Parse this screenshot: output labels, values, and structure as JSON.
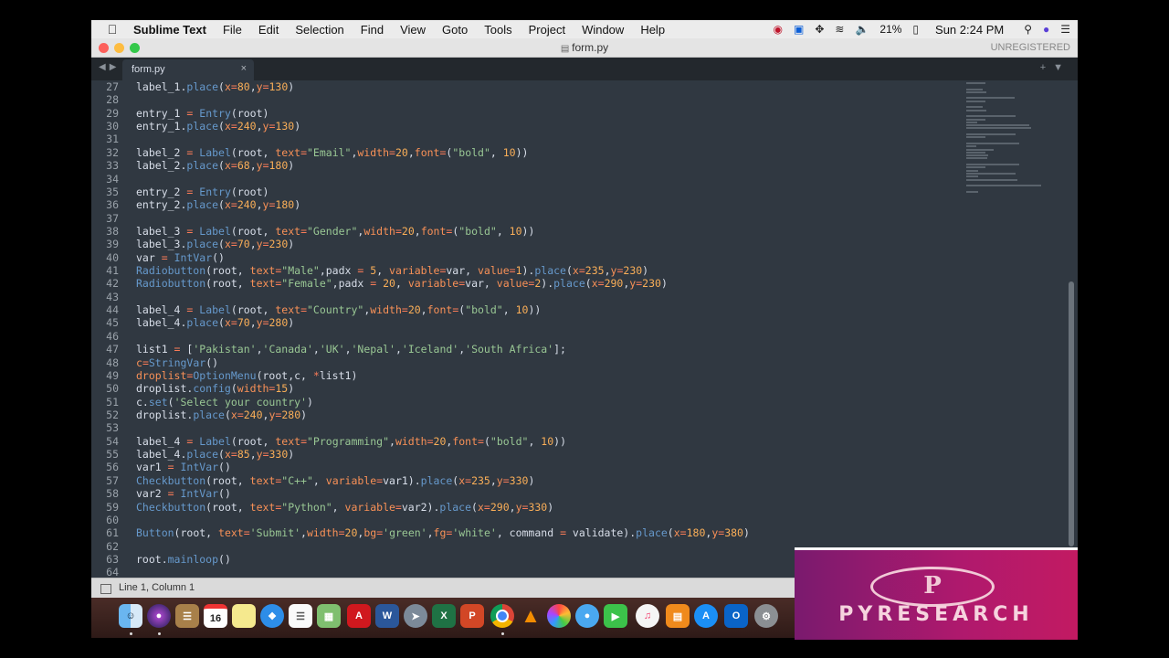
{
  "menubar": {
    "app": "Sublime Text",
    "items": [
      "File",
      "Edit",
      "Selection",
      "Find",
      "View",
      "Goto",
      "Tools",
      "Project",
      "Window",
      "Help"
    ],
    "battery": "21%",
    "clock": "Sun 2:24 PM"
  },
  "window": {
    "title": "form.py",
    "unregistered": "UNREGISTERED"
  },
  "tab": {
    "label": "form.py",
    "close": "×"
  },
  "editor": {
    "line_numbers": [
      "27",
      "28",
      "29",
      "30",
      "31",
      "32",
      "33",
      "34",
      "35",
      "36",
      "37",
      "38",
      "39",
      "40",
      "41",
      "42",
      "43",
      "44",
      "45",
      "46",
      "47",
      "48",
      "49",
      "50",
      "51",
      "52",
      "53",
      "54",
      "55",
      "56",
      "57",
      "58",
      "59",
      "60",
      "61",
      "62",
      "63",
      "64"
    ],
    "lines": [
      "label_1.place(x=80,y=130)",
      "",
      "entry_1 = Entry(root)",
      "entry_1.place(x=240,y=130)",
      "",
      "label_2 = Label(root, text=\"Email\",width=20,font=(\"bold\", 10))",
      "label_2.place(x=68,y=180)",
      "",
      "entry_2 = Entry(root)",
      "entry_2.place(x=240,y=180)",
      "",
      "label_3 = Label(root, text=\"Gender\",width=20,font=(\"bold\", 10))",
      "label_3.place(x=70,y=230)",
      "var = IntVar()",
      "Radiobutton(root, text=\"Male\",padx = 5, variable=var, value=1).place(x=235,y=230)",
      "Radiobutton(root, text=\"Female\",padx = 20, variable=var, value=2).place(x=290,y=230)",
      "",
      "label_4 = Label(root, text=\"Country\",width=20,font=(\"bold\", 10))",
      "label_4.place(x=70,y=280)",
      "",
      "list1 = ['Pakistan','Canada','UK','Nepal','Iceland','South Africa'];",
      "c=StringVar()",
      "droplist=OptionMenu(root,c, *list1)",
      "droplist.config(width=15)",
      "c.set('Select your country')",
      "droplist.place(x=240,y=280)",
      "",
      "label_4 = Label(root, text=\"Programming\",width=20,font=(\"bold\", 10))",
      "label_4.place(x=85,y=330)",
      "var1 = IntVar()",
      "Checkbutton(root, text=\"C++\", variable=var1).place(x=235,y=330)",
      "var2 = IntVar()",
      "Checkbutton(root, text=\"Python\", variable=var2).place(x=290,y=330)",
      "",
      "Button(root, text='Submit',width=20,bg='green',fg='white', command = validate).place(x=180,y=380)",
      "",
      "root.mainloop()",
      ""
    ]
  },
  "statusbar": {
    "position": "Line 1, Column 1"
  },
  "dock": {
    "calendar_day": "16",
    "apps": [
      "finder-icon",
      "siri-icon",
      "notes-icon",
      "calendar-icon",
      "stickies-icon",
      "safari-icon",
      "reminders-icon",
      "preview-icon",
      "acrobat-icon",
      "word-icon",
      "launchpad-icon",
      "excel-icon",
      "powerpoint-icon",
      "chrome-icon",
      "vlc-icon",
      "photos-icon",
      "messages-icon",
      "facetime-icon",
      "music-icon",
      "books-icon",
      "appstore-icon",
      "outlook-icon",
      "settings-icon"
    ]
  },
  "overlay": {
    "logo_letter": "P",
    "logo_text": "PYRESEARCH"
  },
  "colors": {
    "editor_bg": "#303841",
    "keyword": "#f99157",
    "function": "#6699cc",
    "string": "#99c794",
    "operator": "#f97b58",
    "number": "#f9ae58"
  }
}
